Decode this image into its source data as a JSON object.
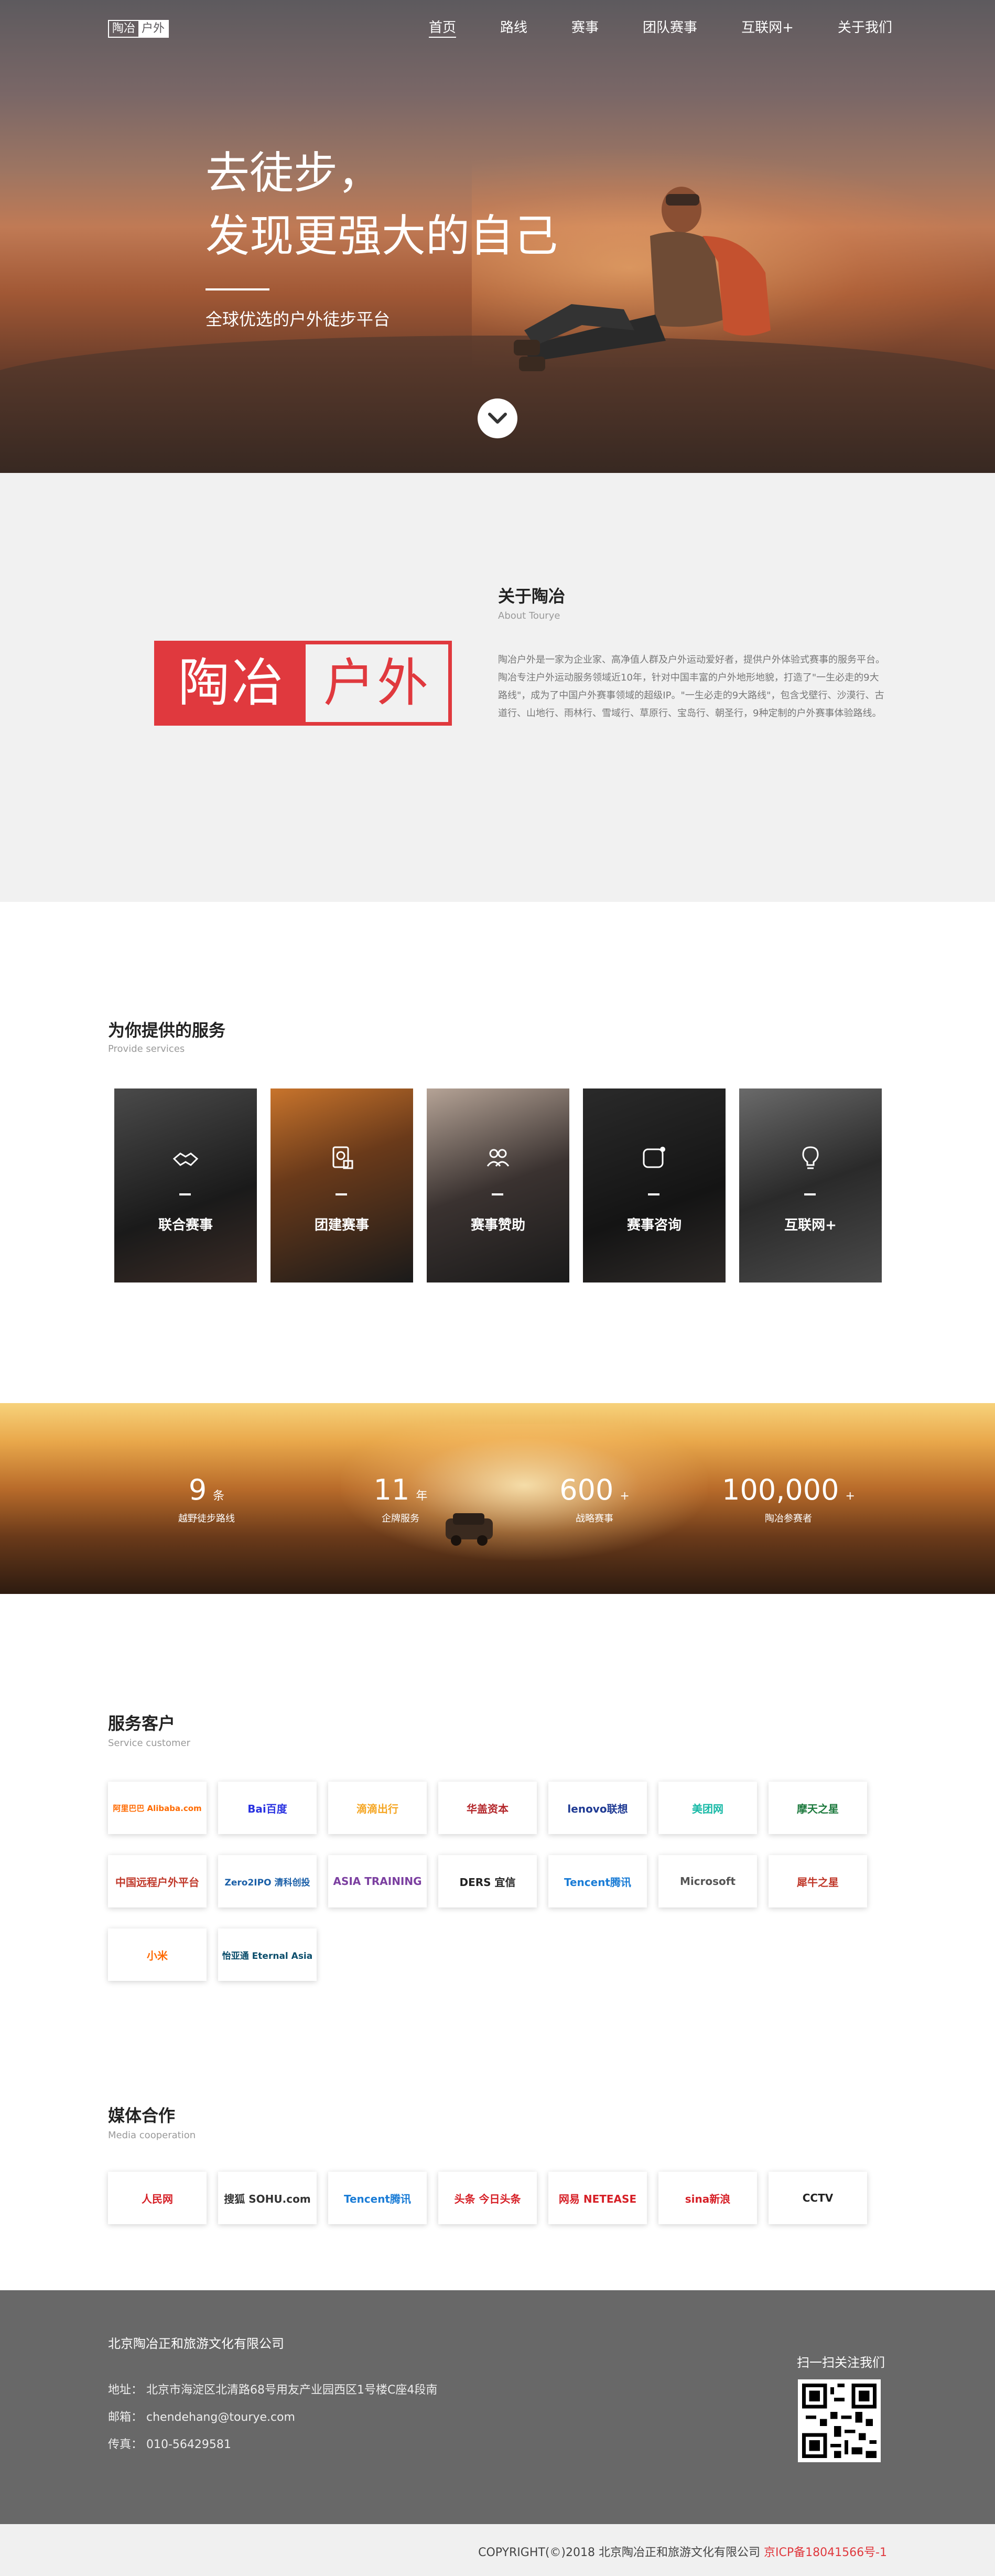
{
  "nav": {
    "logo_left": "陶冶",
    "logo_right": "户外",
    "items": [
      "首页",
      "路线",
      "赛事",
      "团队赛事",
      "互联网+",
      "关于我们"
    ]
  },
  "hero": {
    "title_line1": "去徒步，",
    "title_line2": "发现更强大的自己",
    "subtitle": "全球优选的户外徒步平台"
  },
  "about": {
    "logo_left": "陶冶",
    "logo_right": "户外",
    "title": "关于陶冶",
    "subtitle": "About Tourye",
    "text": "陶冶户外是一家为企业家、高净值人群及户外运动爱好者，提供户外体验式赛事的服务平台。陶冶专注户外运动服务领域近10年，针对中国丰富的户外地形地貌，打造了\"一生必走的9大路线\"，成为了中国户外赛事领域的超级IP。\"一生必走的9大路线\"，包含戈壁行、沙漠行、古道行、山地行、雨林行、雪域行、草原行、宝岛行、朝圣行，9种定制的户外赛事体验路线。"
  },
  "services": {
    "title": "为你提供的服务",
    "subtitle": "Provide services",
    "cards": [
      {
        "label": "联合赛事",
        "icon": "handshake-icon"
      },
      {
        "label": "团建赛事",
        "icon": "money-icon"
      },
      {
        "label": "赛事赞助",
        "icon": "group-icon"
      },
      {
        "label": "赛事咨询",
        "icon": "chat-icon"
      },
      {
        "label": "互联网+",
        "icon": "lightbulb-icon"
      }
    ]
  },
  "stats": [
    {
      "num": "9",
      "unit": "条",
      "cap": "越野徒步路线"
    },
    {
      "num": "11",
      "unit": "年",
      "cap": "企牌服务"
    },
    {
      "num": "600",
      "unit": "+",
      "cap": "战略赛事"
    },
    {
      "num": "100,000",
      "unit": "+",
      "cap": "陶冶参赛者"
    }
  ],
  "clients": {
    "title": "服务客户",
    "subtitle": "Service customer",
    "logos": [
      {
        "name": "阿里巴巴 Alibaba.com",
        "color": "#ff6a00"
      },
      {
        "name": "Bai百度",
        "color": "#2932e1"
      },
      {
        "name": "滴滴出行",
        "color": "#f5a623"
      },
      {
        "name": "华盖资本",
        "color": "#b3262a"
      },
      {
        "name": "lenovo联想",
        "color": "#1f3a93"
      },
      {
        "name": "美团网",
        "color": "#17b9a6"
      },
      {
        "name": "摩天之星",
        "color": "#1d7a3e"
      },
      {
        "name": "中国远程户外平台",
        "color": "#c0392b"
      },
      {
        "name": "Zero2IPO 清科创投",
        "color": "#1a5fa8"
      },
      {
        "name": "ASIA TRAINING",
        "color": "#7b3fa0"
      },
      {
        "name": "DERS 宜信",
        "color": "#222222"
      },
      {
        "name": "Tencent腾讯",
        "color": "#1a7cd6"
      },
      {
        "name": "Microsoft",
        "color": "#555555"
      },
      {
        "name": "犀牛之星",
        "color": "#c0392b"
      },
      {
        "name": "小米",
        "color": "#ff6900"
      },
      {
        "name": "怡亚通 Eternal Asia",
        "color": "#0a4d6b"
      }
    ]
  },
  "media": {
    "title": "媒体合作",
    "subtitle": "Media cooperation",
    "logos": [
      {
        "name": "人民网",
        "color": "#d61f26"
      },
      {
        "name": "搜狐 SOHU.com",
        "color": "#333333"
      },
      {
        "name": "Tencent腾讯",
        "color": "#1a7cd6"
      },
      {
        "name": "头条 今日头条",
        "color": "#d61f26"
      },
      {
        "name": "网易 NETEASE",
        "color": "#d61f26"
      },
      {
        "name": "sina新浪",
        "color": "#d61f26"
      },
      {
        "name": "CCTV",
        "color": "#222222"
      }
    ]
  },
  "footer": {
    "company": "北京陶冶正和旅游文化有限公司",
    "address": "地址：  北京市海淀区北清路68号用友产业园西区1号楼C座4段南",
    "email": "邮箱：  chendehang@tourye.com",
    "fax": "传真：  010-56429581",
    "follow": "扫一扫关注我们",
    "copyright": "COPYRIGHT(©)2018  北京陶冶正和旅游文化有限公司 ",
    "icp": "京ICP备18041566号-1"
  }
}
